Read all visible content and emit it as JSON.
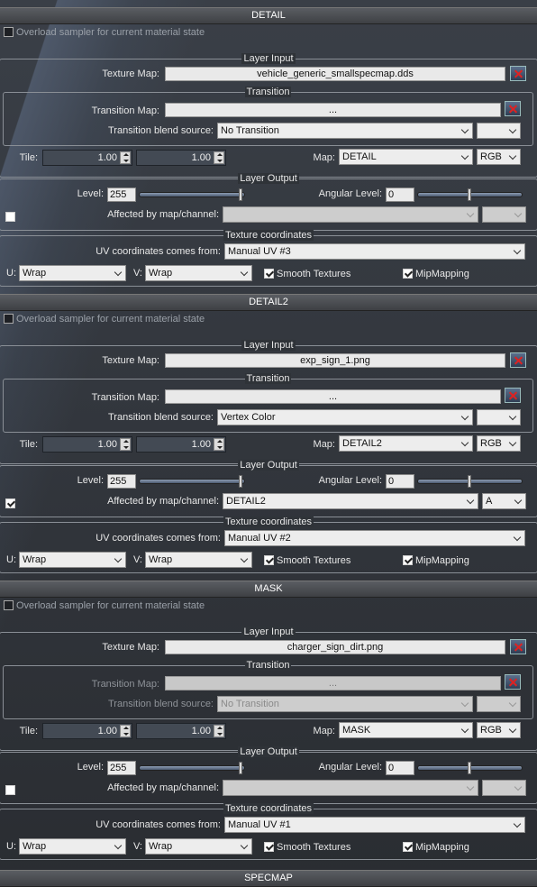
{
  "common": {
    "overload_label": "Overload sampler for current material state",
    "layer_input_title": "Layer Input",
    "texture_map_label": "Texture Map:",
    "transition_title": "Transition",
    "transition_map_label": "Transition Map:",
    "transition_blend_label": "Transition blend source:",
    "tile_label": "Tile:",
    "map_label": "Map:",
    "layer_output_title": "Layer Output",
    "level_label": "Level:",
    "angular_level_label": "Angular Level:",
    "affected_label": "Affected by map/channel:",
    "texcoords_title": "Texture coordinates",
    "uv_label": "UV coordinates comes from:",
    "u_label": "U:",
    "v_label": "V:",
    "smooth_label": "Smooth Textures",
    "mip_label": "MipMapping"
  },
  "panels": [
    {
      "title": "DETAIL",
      "texture_map": "vehicle_generic_smallspecmap.dds",
      "transition_map": "...",
      "transition_blend": "No Transition",
      "transition_blend_channel": "",
      "tile_u": "1.00",
      "tile_v": "1.00",
      "map": "DETAIL",
      "channel": "RGB",
      "level": "255",
      "level_fraction": 1.0,
      "angular_level": "0",
      "angular_fraction": 0.5,
      "affected_checked": false,
      "affected_map": "",
      "affected_channel": "",
      "uv_source": "Manual UV #3",
      "u_wrap": "Wrap",
      "v_wrap": "Wrap",
      "smooth": true,
      "mip": true
    },
    {
      "title": "DETAIL2",
      "texture_map": "exp_sign_1.png",
      "transition_map": "...",
      "transition_blend": "Vertex Color",
      "transition_blend_channel": "",
      "tile_u": "1.00",
      "tile_v": "1.00",
      "map": "DETAIL2",
      "channel": "RGB",
      "level": "255",
      "level_fraction": 1.0,
      "angular_level": "0",
      "angular_fraction": 0.5,
      "affected_checked": true,
      "affected_map": "DETAIL2",
      "affected_channel": "A",
      "uv_source": "Manual UV #2",
      "u_wrap": "Wrap",
      "v_wrap": "Wrap",
      "smooth": true,
      "mip": true
    },
    {
      "title": "MASK",
      "texture_map": "charger_sign_dirt.png",
      "transition_map": "...",
      "transition_blend": "No Transition",
      "transition_blend_channel": "",
      "tile_u": "1.00",
      "tile_v": "1.00",
      "map": "MASK",
      "channel": "RGB",
      "level": "255",
      "level_fraction": 1.0,
      "angular_level": "0",
      "angular_fraction": 0.5,
      "affected_checked": false,
      "affected_map": "",
      "affected_channel": "",
      "uv_source": "Manual UV #1",
      "u_wrap": "Wrap",
      "v_wrap": "Wrap",
      "smooth": true,
      "mip": true
    }
  ],
  "next_panel_title": "SPECMAP"
}
